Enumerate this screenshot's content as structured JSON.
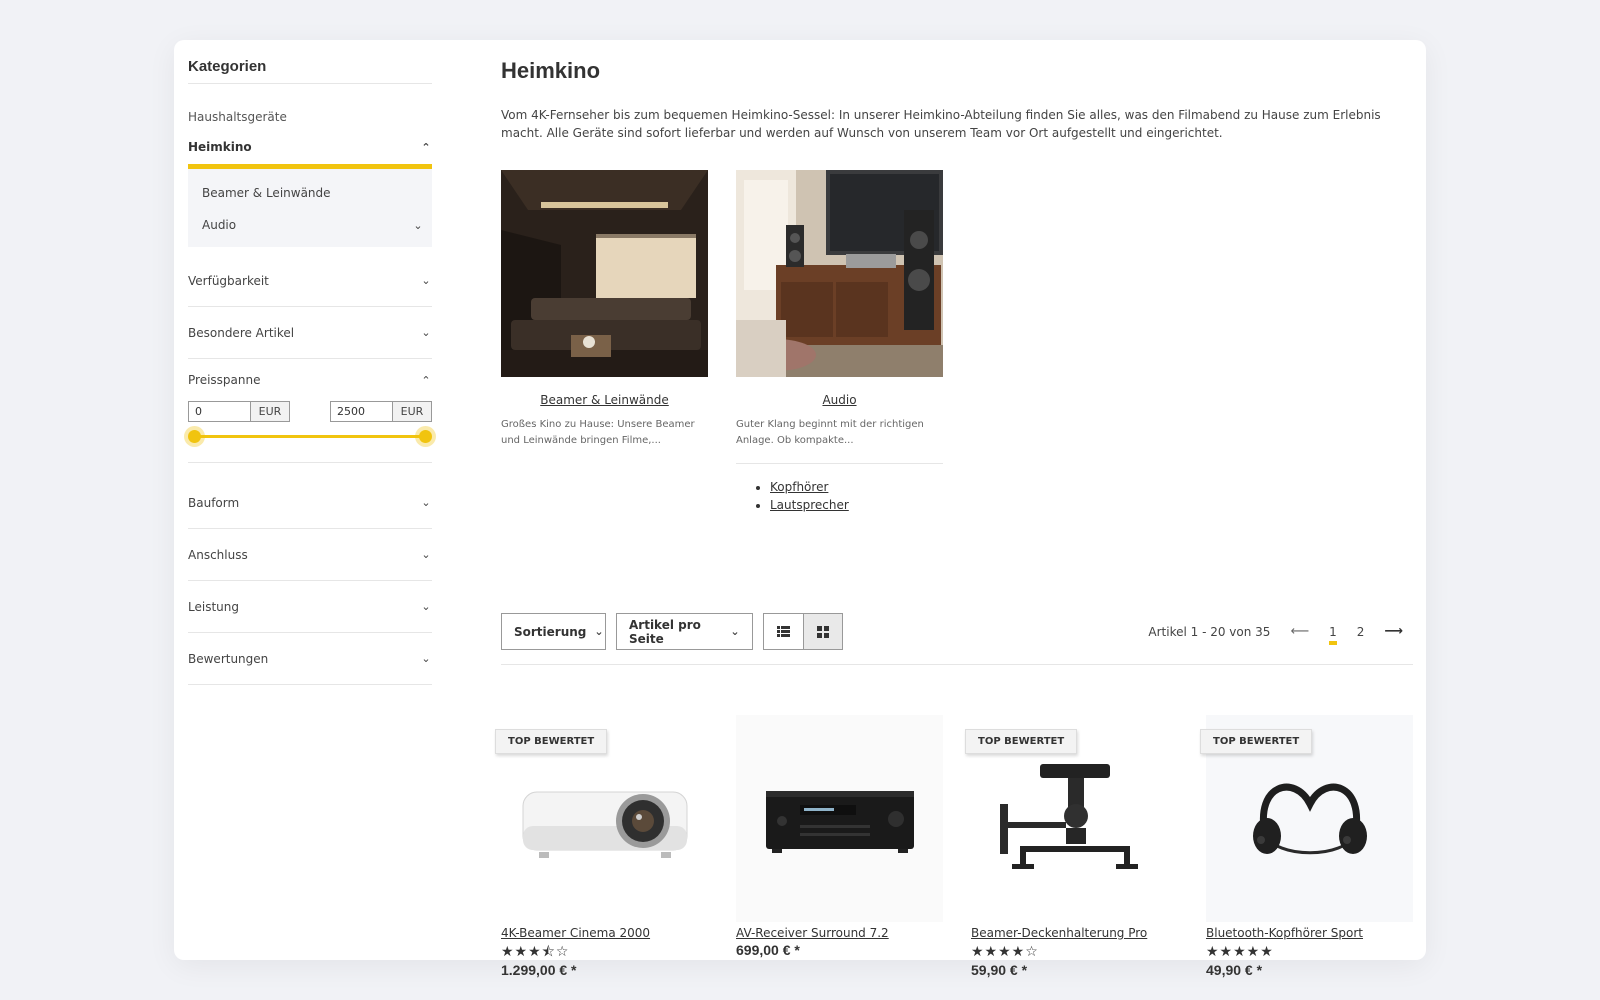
{
  "sidebar": {
    "title": "Kategorien",
    "cat_link": "Haushaltsgeräte",
    "cat_active": "Heimkino",
    "sub_items": [
      "Beamer & Leinwände",
      "Audio"
    ],
    "filters_top": [
      "Verfügbarkeit",
      "Besondere Artikel"
    ],
    "price": {
      "label": "Preisspanne",
      "min": "0",
      "max": "2500",
      "currency": "EUR"
    },
    "filters_bottom": [
      "Bauform",
      "Anschluss",
      "Leistung",
      "Bewertungen"
    ]
  },
  "main": {
    "title": "Heimkino",
    "intro": "Vom 4K-Fernseher bis zum bequemen Heimkino-Sessel: In unserer Heimkino-Abteilung finden Sie alles, was den Filmabend zu Hause zum Erlebnis macht. Alle Geräte sind sofort lieferbar und werden auf Wunsch von unserem Team vor Ort aufgestellt und eingerichtet.",
    "categories": [
      {
        "name": "Beamer & Leinwände",
        "desc": "Großes Kino zu Hause: Unsere Beamer und Leinwände bringen Filme,..."
      },
      {
        "name": "Audio",
        "desc": "Guter Klang beginnt mit der richtigen Anlage. Ob kompakte...",
        "subs": [
          "Kopfhörer",
          "Lautsprecher"
        ]
      }
    ]
  },
  "toolbar": {
    "sort_label": "Sortierung",
    "per_page_label": "Artikel pro Seite",
    "count_text": "Artikel 1 - 20 von 35",
    "pages": [
      "1",
      "2"
    ]
  },
  "products": [
    {
      "name": "4K-Beamer Cinema 2000",
      "price": "1.299,00 € *",
      "rating": 3.5,
      "stars": "★★★⯪☆",
      "badge": "TOP BEWERTET"
    },
    {
      "name": "AV-Receiver Surround 7.2",
      "price": "699,00 € *"
    },
    {
      "name": "Beamer-Deckenhalterung Pro",
      "price": "59,90 € *",
      "rating": 4,
      "stars": "★★★★☆",
      "badge": "TOP BEWERTET"
    },
    {
      "name": "Bluetooth-Kopfhörer Sport",
      "price": "49,90 € *",
      "rating": 5,
      "stars": "★★★★★",
      "badge": "TOP BEWERTET"
    }
  ],
  "colors": {
    "accent": "#f1c40f",
    "background": "#f1f2f6",
    "text": "#333333"
  }
}
